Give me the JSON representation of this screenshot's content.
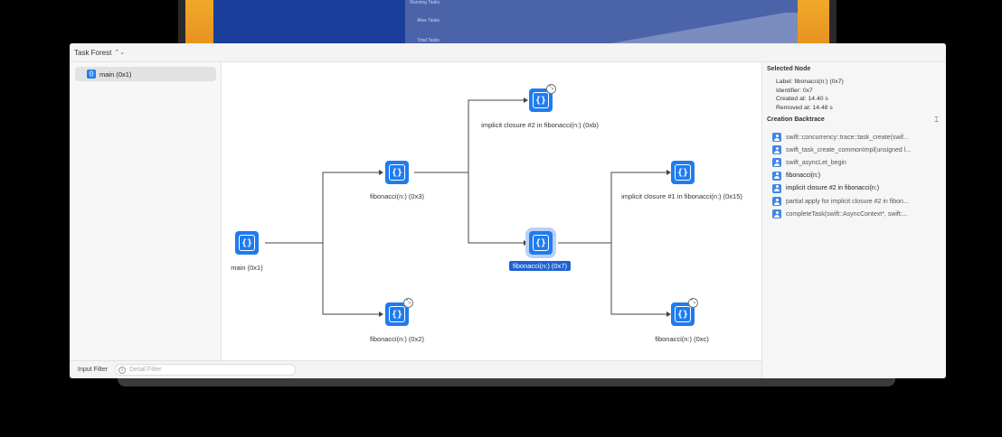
{
  "background": {
    "rows": [
      "Running Tasks",
      "Alive Tasks",
      "Total Tasks"
    ]
  },
  "toolbar": {
    "title": "Task Forest",
    "chevron": "⌃⌄"
  },
  "sidebar": {
    "items": [
      {
        "label": "main (0x1)"
      }
    ]
  },
  "graph": {
    "nodes": [
      {
        "id": "main",
        "label": "main (0x1)"
      },
      {
        "id": "fib3",
        "label": "fibonacci(n:) (0x3)"
      },
      {
        "id": "fib2",
        "label": "fibonacci(n:) (0x2)"
      },
      {
        "id": "closB",
        "label": "implicit closure #2 in fibonacci(n:) (0xb)"
      },
      {
        "id": "fib7",
        "label": "fibonacci(n:) (0x7)"
      },
      {
        "id": "clos15",
        "label": "implicit closure #1 in fibonacci(n:) (0x15)"
      },
      {
        "id": "fibC",
        "label": "fibonacci(n:) (0xc)"
      }
    ],
    "icon_glyph": "{}",
    "badge_glyph": "⤡"
  },
  "inspector": {
    "selected_title": "Selected Node",
    "label": "Label: fibonacci(n:) (0x7)",
    "identifier": "Identifier: 0x7",
    "created": "Created at: 14.40 s",
    "removed": "Removed at: 14.48 s",
    "backtrace_title": "Creation Backtrace",
    "backtrace": [
      "swift::concurrency::trace::task_create(swif...",
      "swift_task_create_commonImpl(unsigned l...",
      "swift_asyncLet_begin",
      "fibonacci(n:)",
      "implicit closure #2 in fibonacci(n:)",
      "partial apply for implicit closure #2 in fibon...",
      "completeTask(swift::AsyncContext*, swift:..."
    ]
  },
  "bottombar": {
    "label": "Input Filter",
    "placeholder": "Detail Filter"
  }
}
